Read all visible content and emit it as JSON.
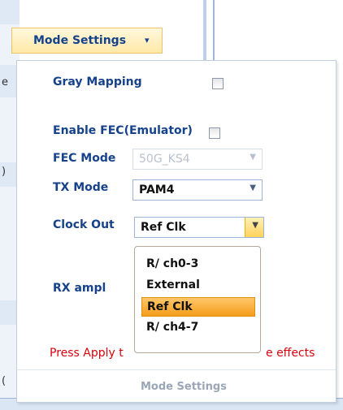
{
  "ribbon": {
    "button_label": "Mode Settings",
    "caret": "▾"
  },
  "background": {
    "left_char_top": "e",
    "left_char_mid": ")",
    "left_char_bottom": "("
  },
  "panel": {
    "gray_mapping": {
      "label": "Gray Mapping",
      "checked": false
    },
    "enable_fec": {
      "label": "Enable FEC(Emulator)",
      "checked": false
    },
    "fec_mode": {
      "label": "FEC Mode",
      "value": "50G_KS4",
      "enabled": false
    },
    "tx_mode": {
      "label": "TX Mode",
      "value": "PAM4"
    },
    "clock_out": {
      "label": "Clock Out",
      "value": "Ref Clk",
      "options": [
        "R/ ch0-3",
        "External",
        "Ref Clk",
        "R/ ch4-7"
      ],
      "selected_index": 2
    },
    "rx_ampl": {
      "label": "RX ampl"
    },
    "warning_left": "Press Apply t",
    "warning_right": "e effects",
    "footer_title": "Mode Settings"
  },
  "colors": {
    "label": "#15428b",
    "warning": "#d8000c",
    "selection": "#f59d1b"
  }
}
